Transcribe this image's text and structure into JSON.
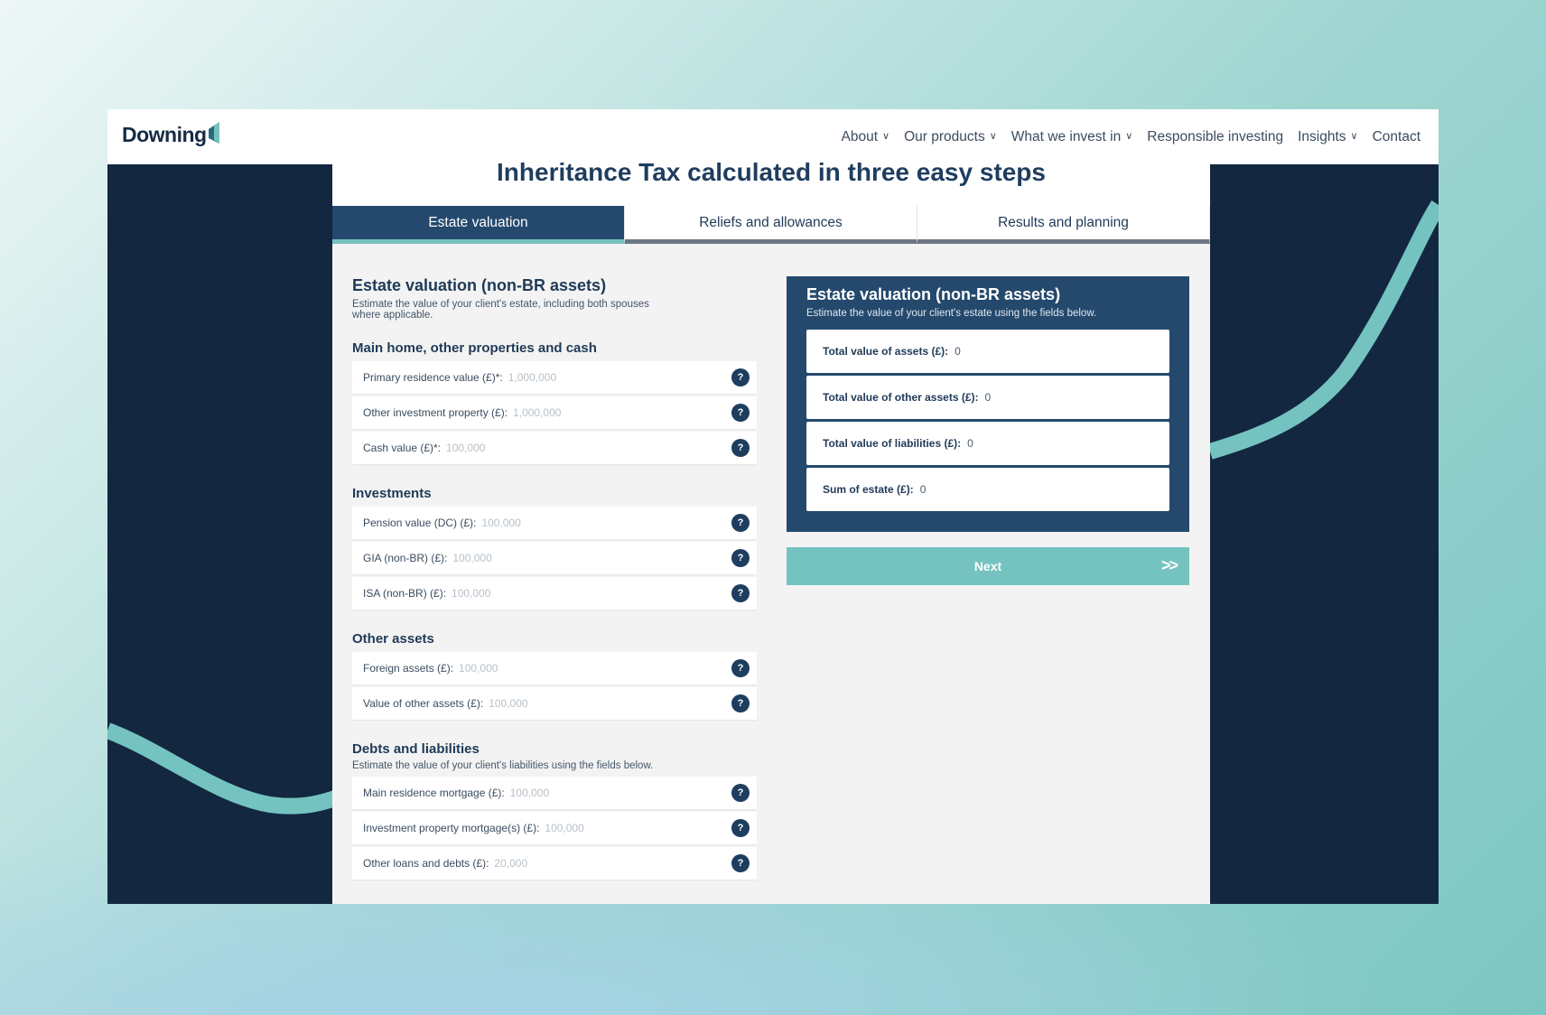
{
  "brand": {
    "name": "Downing",
    "accent": "#74c3c0",
    "navy": "#24496d",
    "dark": "#132740"
  },
  "nav": {
    "items": [
      {
        "label": "About",
        "dropdown": true
      },
      {
        "label": "Our products",
        "dropdown": true
      },
      {
        "label": "What we invest in",
        "dropdown": true
      },
      {
        "label": "Responsible investing",
        "dropdown": false
      },
      {
        "label": "Insights",
        "dropdown": true
      },
      {
        "label": "Contact",
        "dropdown": false
      }
    ]
  },
  "page": {
    "title": "Inheritance Tax calculated in three easy steps"
  },
  "tabs": [
    {
      "label": "Estate valuation",
      "active": true
    },
    {
      "label": "Reliefs and allowances",
      "active": false
    },
    {
      "label": "Results and planning",
      "active": false
    }
  ],
  "form": {
    "title": "Estate valuation (non-BR assets)",
    "description": "Estimate the value of your client's estate, including both spouses where applicable.",
    "groups": [
      {
        "title": "Main home, other properties and cash",
        "fields": [
          {
            "label": "Primary residence value (£)*:",
            "placeholder": "1,000,000",
            "value": ""
          },
          {
            "label": "Other investment property (£):",
            "placeholder": "1,000,000",
            "value": ""
          },
          {
            "label": "Cash value (£)*:",
            "placeholder": "100,000",
            "value": ""
          }
        ]
      },
      {
        "title": "Investments",
        "fields": [
          {
            "label": "Pension value (DC) (£):",
            "placeholder": "100,000",
            "value": ""
          },
          {
            "label": "GIA (non-BR) (£):",
            "placeholder": "100,000",
            "value": ""
          },
          {
            "label": "ISA (non-BR) (£):",
            "placeholder": "100,000",
            "value": ""
          }
        ]
      },
      {
        "title": "Other assets",
        "fields": [
          {
            "label": "Foreign assets (£):",
            "placeholder": "100,000",
            "value": ""
          },
          {
            "label": "Value of other assets (£):",
            "placeholder": "100,000",
            "value": ""
          }
        ]
      },
      {
        "title": "Debts and liabilities",
        "description": "Estimate the value of your client's liabilities using the fields below.",
        "fields": [
          {
            "label": "Main residence mortgage (£):",
            "placeholder": "100,000",
            "value": ""
          },
          {
            "label": "Investment property mortgage(s) (£):",
            "placeholder": "100,000",
            "value": ""
          },
          {
            "label": "Other loans and debts (£):",
            "placeholder": "20,000",
            "value": ""
          }
        ]
      }
    ]
  },
  "summary": {
    "title": "Estate valuation (non-BR assets)",
    "description": "Estimate the value of your client's estate using the fields below.",
    "rows": [
      {
        "label": "Total value of assets (£):",
        "value": "0"
      },
      {
        "label": "Total value of other assets (£):",
        "value": "0"
      },
      {
        "label": "Total value of liabilities (£):",
        "value": "0"
      },
      {
        "label": "Sum of estate (£):",
        "value": "0"
      }
    ]
  },
  "next_button": {
    "label": "Next",
    "icon": "double-chevron-right-icon"
  },
  "help_icon_glyph": "?"
}
